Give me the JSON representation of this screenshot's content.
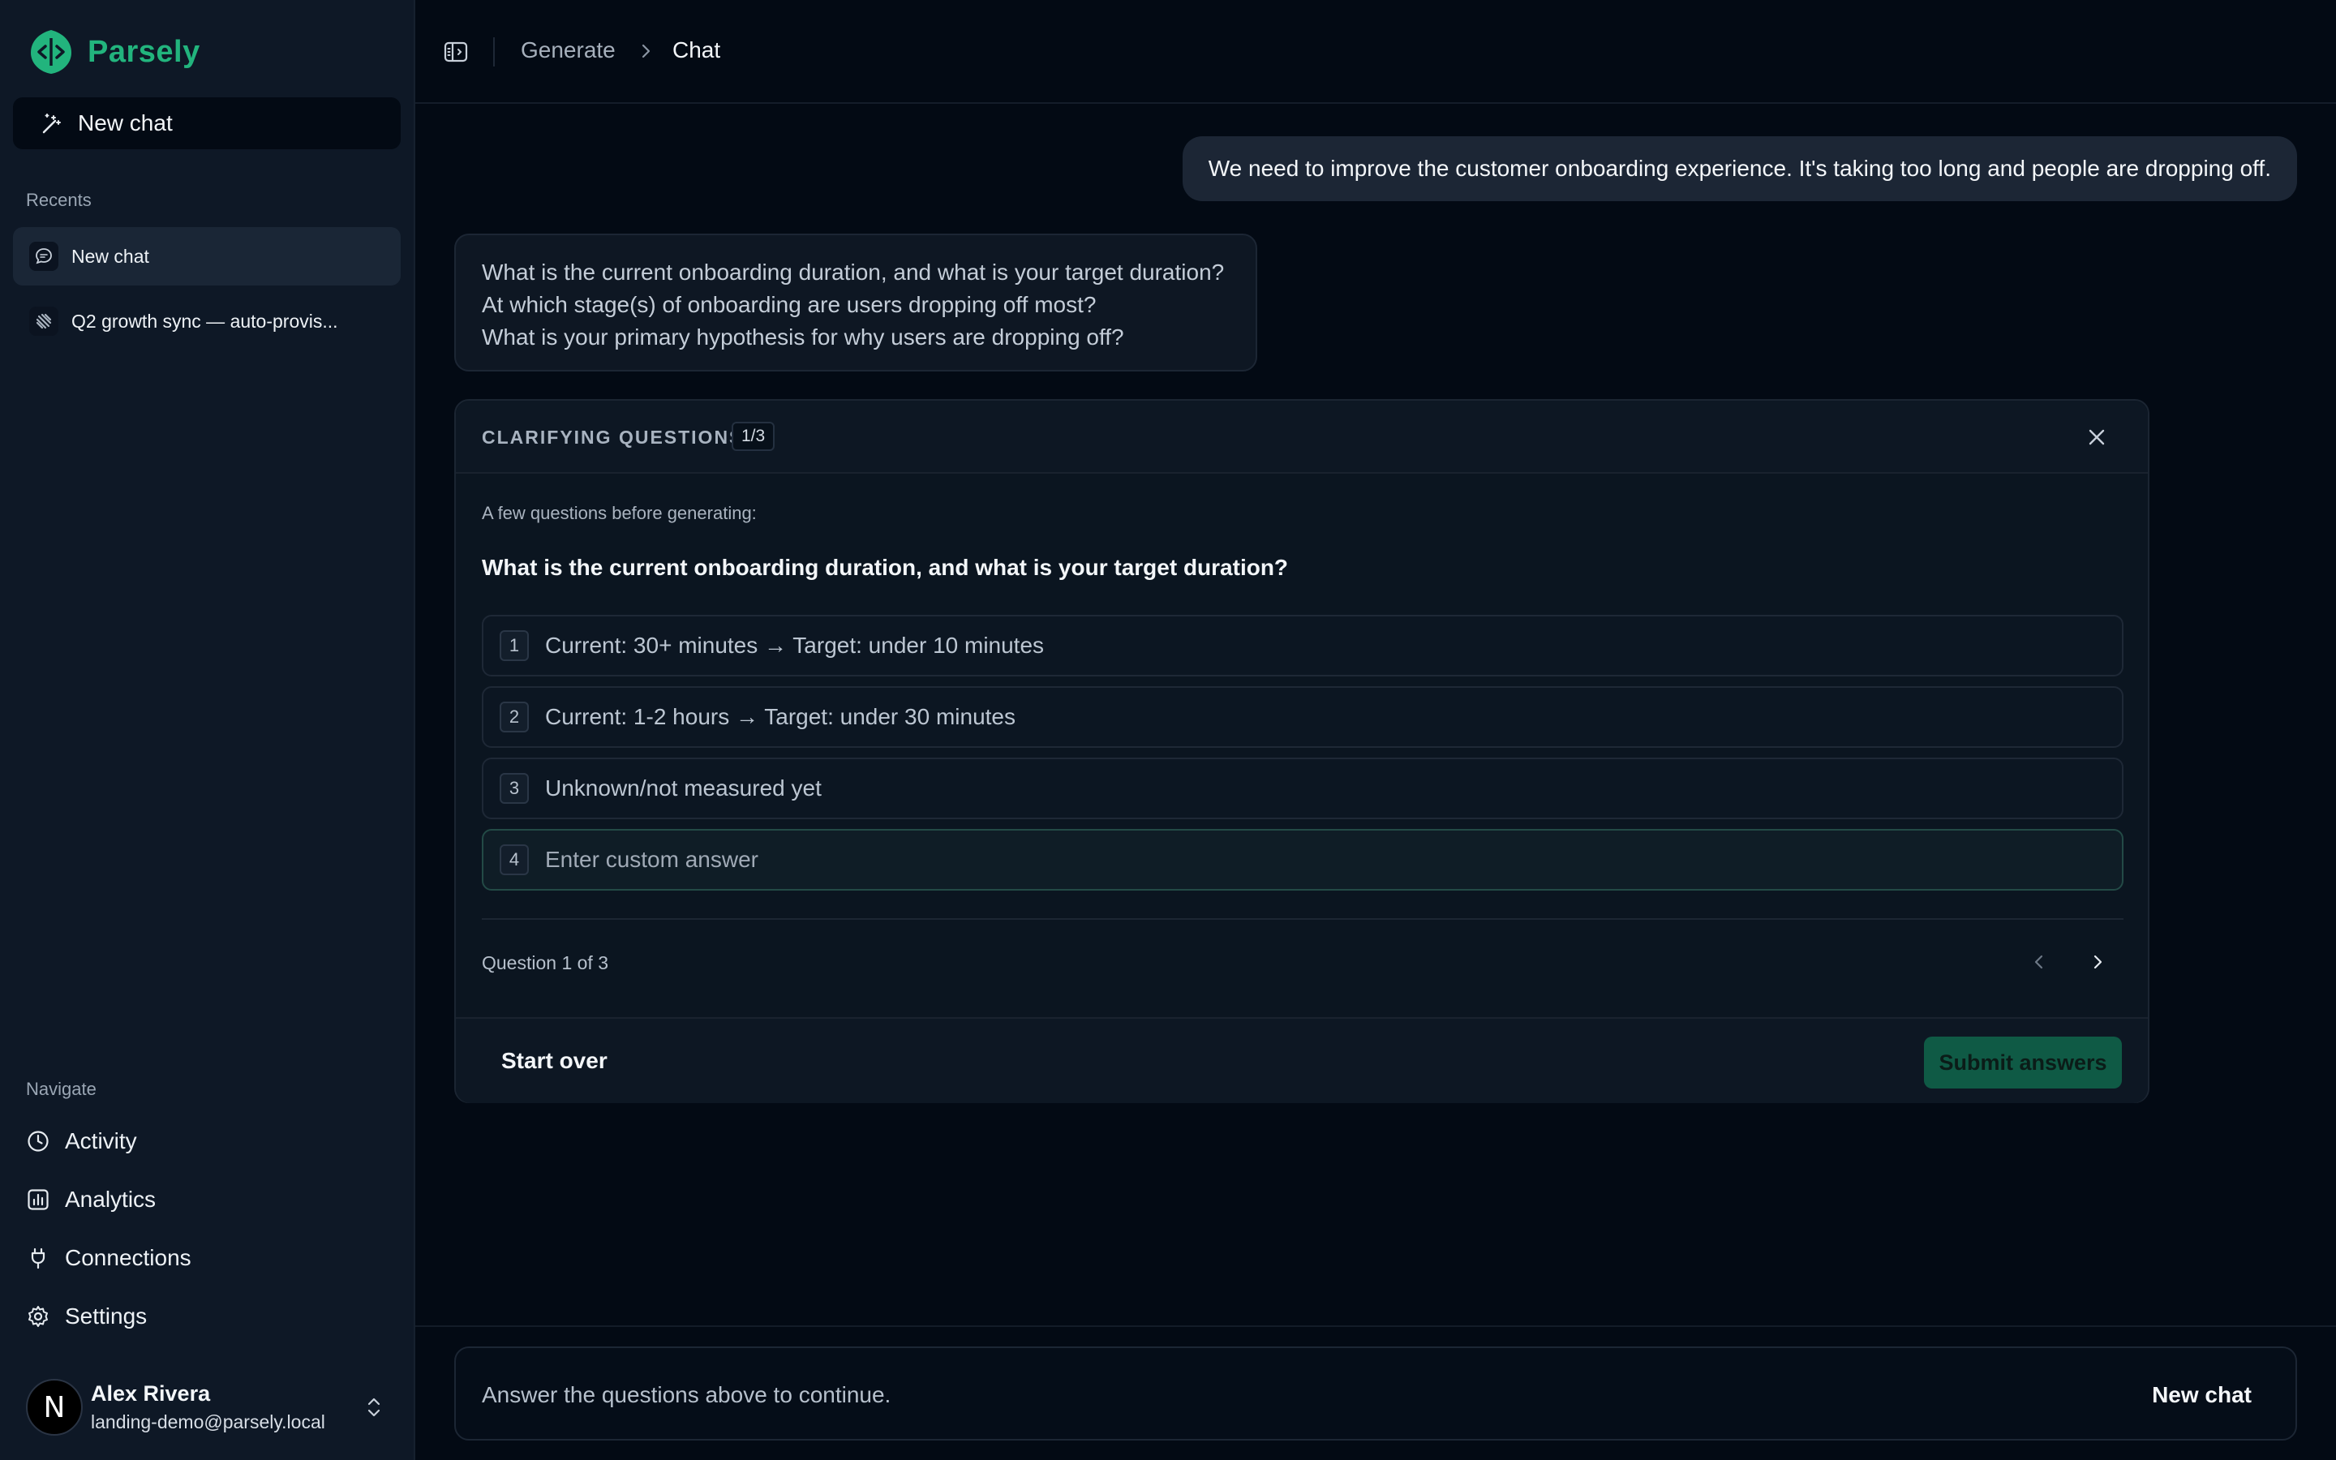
{
  "brand": {
    "name": "Parsely",
    "accent": "#22b47d"
  },
  "sidebar": {
    "new_chat_label": "New chat",
    "recents_label": "Recents",
    "recents": [
      {
        "label": "New chat",
        "icon": "chat-bubble-icon",
        "active": true
      },
      {
        "label": "Q2 growth sync — auto-provis...",
        "icon": "linear-app-icon",
        "active": false
      }
    ],
    "navigate_label": "Navigate",
    "nav": [
      {
        "label": "Activity",
        "icon": "clock-icon"
      },
      {
        "label": "Analytics",
        "icon": "bar-chart-icon"
      },
      {
        "label": "Connections",
        "icon": "plug-icon"
      },
      {
        "label": "Settings",
        "icon": "gear-icon"
      }
    ],
    "user": {
      "initial": "N",
      "name": "Alex Rivera",
      "email": "landing-demo@parsely.local"
    }
  },
  "topbar": {
    "breadcrumb_parent": "Generate",
    "breadcrumb_current": "Chat"
  },
  "chat": {
    "user_message": "We need to improve the customer onboarding experience. It's taking too long and people are dropping off.",
    "assistant_lines": [
      "What is the current onboarding duration, and what is your target duration?",
      "At which stage(s) of onboarding are users dropping off most?",
      "What is your primary hypothesis for why users are dropping off?"
    ]
  },
  "questions_card": {
    "title": "CLARIFYING QUESTIONS",
    "count": "1/3",
    "intro": "A few questions before generating:",
    "question": "What is the current onboarding duration, and what is your target duration?",
    "options": [
      {
        "num": "1",
        "label": "Current: 30+ minutes → Target: under 10 minutes"
      },
      {
        "num": "2",
        "label": "Current: 1-2 hours → Target: under 30 minutes"
      },
      {
        "num": "3",
        "label": "Unknown/not measured yet"
      }
    ],
    "custom": {
      "num": "4",
      "placeholder": "Enter custom answer"
    },
    "progress": "Question 1 of 3",
    "start_over_label": "Start over",
    "submit_label": "Submit answers",
    "submit_color": "#0f5a45"
  },
  "composer": {
    "placeholder": "Answer the questions above to continue.",
    "new_chat_label": "New chat"
  }
}
